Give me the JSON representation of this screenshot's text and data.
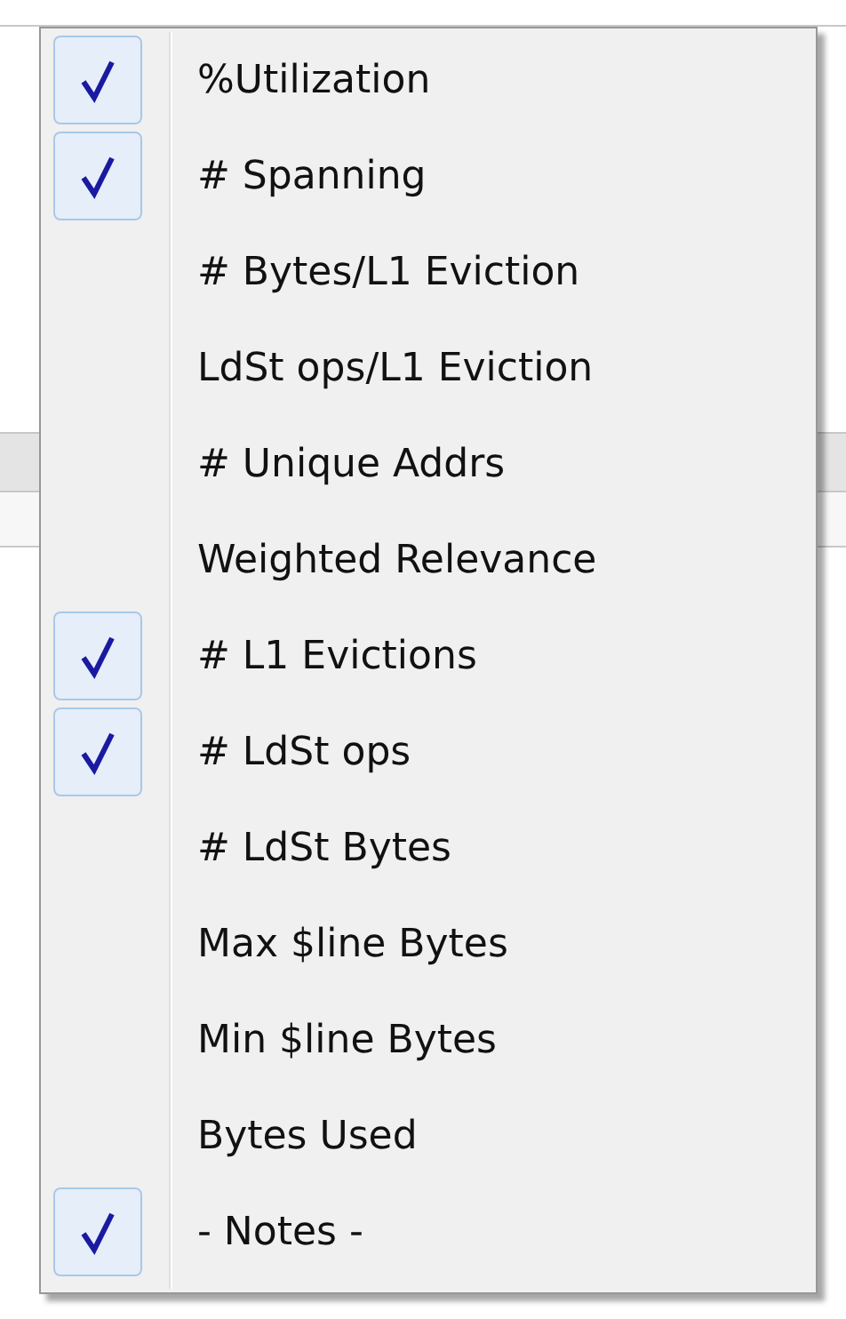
{
  "menu": {
    "items": [
      {
        "label": "%Utilization",
        "checked": true
      },
      {
        "label": "# Spanning",
        "checked": true
      },
      {
        "label": "# Bytes/L1 Eviction",
        "checked": false
      },
      {
        "label": "LdSt ops/L1 Eviction",
        "checked": false
      },
      {
        "label": "# Unique Addrs",
        "checked": false
      },
      {
        "label": "Weighted Relevance",
        "checked": false
      },
      {
        "label": "# L1 Evictions",
        "checked": true
      },
      {
        "label": "# LdSt ops",
        "checked": true
      },
      {
        "label": "# LdSt Bytes",
        "checked": false
      },
      {
        "label": "Max $line Bytes",
        "checked": false
      },
      {
        "label": "Min $line Bytes",
        "checked": false
      },
      {
        "label": "Bytes Used",
        "checked": false
      },
      {
        "label": "- Notes -",
        "checked": true
      }
    ]
  }
}
